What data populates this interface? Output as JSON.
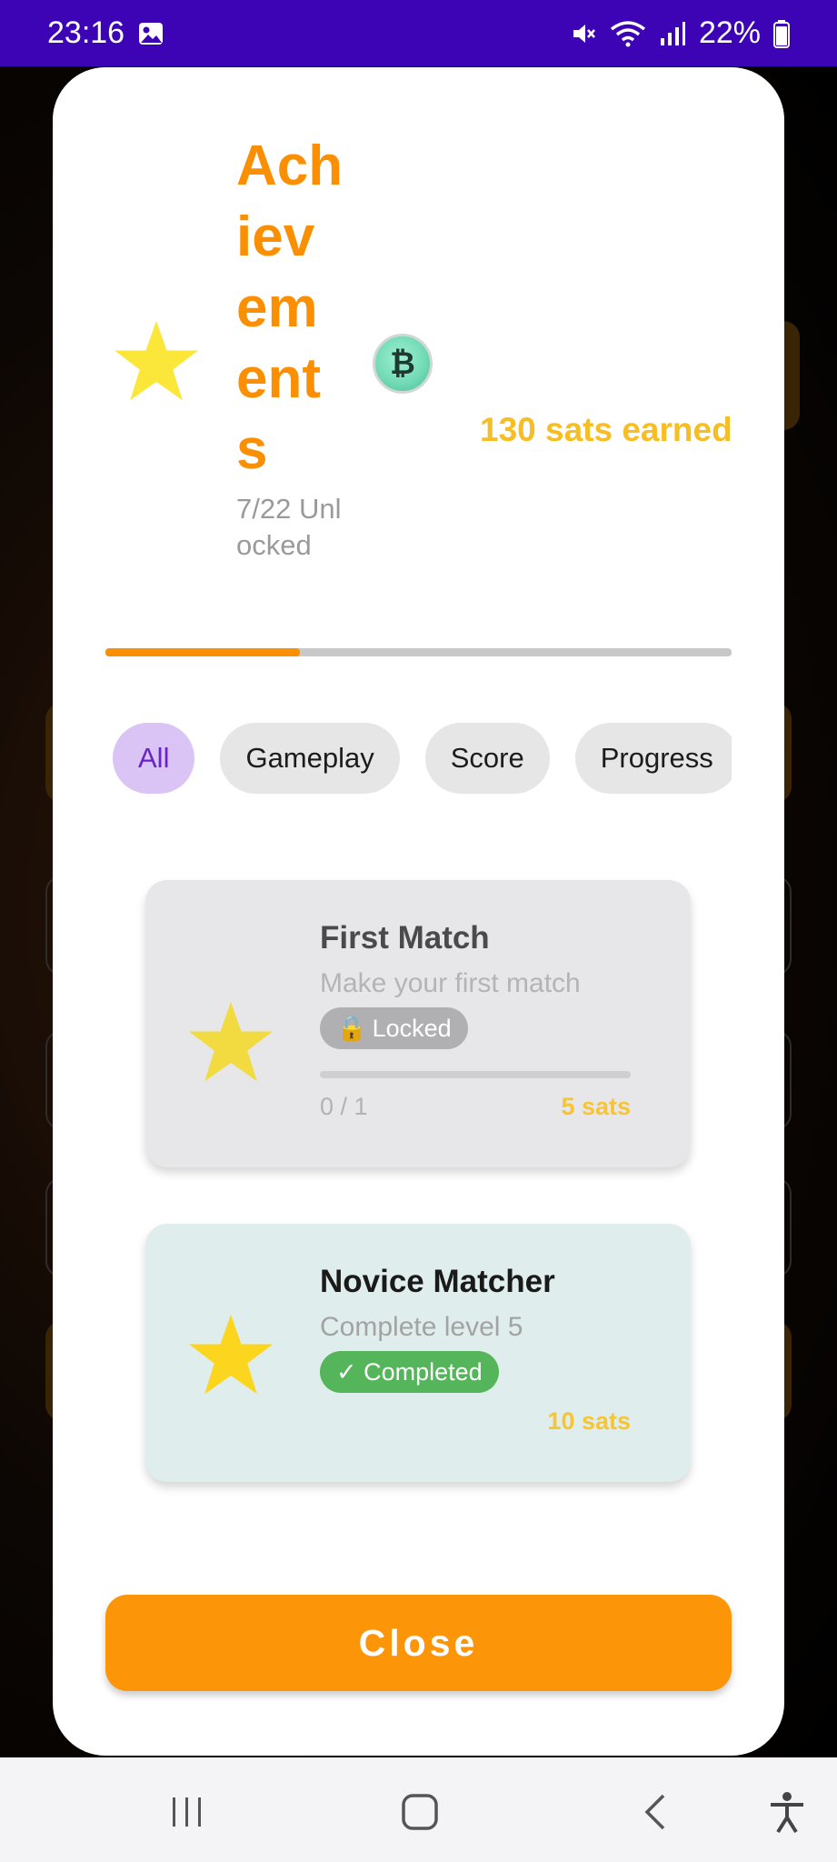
{
  "status_bar": {
    "time": "23:16",
    "battery": "22%",
    "icons": [
      "gallery-icon",
      "mute-icon",
      "wifi-icon",
      "signal-icon",
      "battery-icon"
    ]
  },
  "header": {
    "title": "Achievements",
    "unlocked": "7/22 Unlocked",
    "sats_earned": "130 sats earned",
    "coin_symbol": "₿",
    "progress": 0.31
  },
  "filters": {
    "chips": [
      "All",
      "Gameplay",
      "Score",
      "Progress"
    ],
    "active": "All"
  },
  "achievements": [
    {
      "title": "First Match",
      "description": "Make your first match",
      "status": "Locked",
      "status_icon": "🔒",
      "progress_text": "0 / 1",
      "reward": "5 sats"
    },
    {
      "title": "Novice Matcher",
      "description": "Complete level 5",
      "status": "✓ Completed",
      "reward": "10 sats"
    }
  ],
  "close_label": "Close",
  "colors": {
    "accent": "#fb8f04",
    "status_bar": "#3d04b6",
    "sats": "#f7bd24",
    "completed": "#55b55a",
    "chip_active": "#d9c4f5"
  }
}
